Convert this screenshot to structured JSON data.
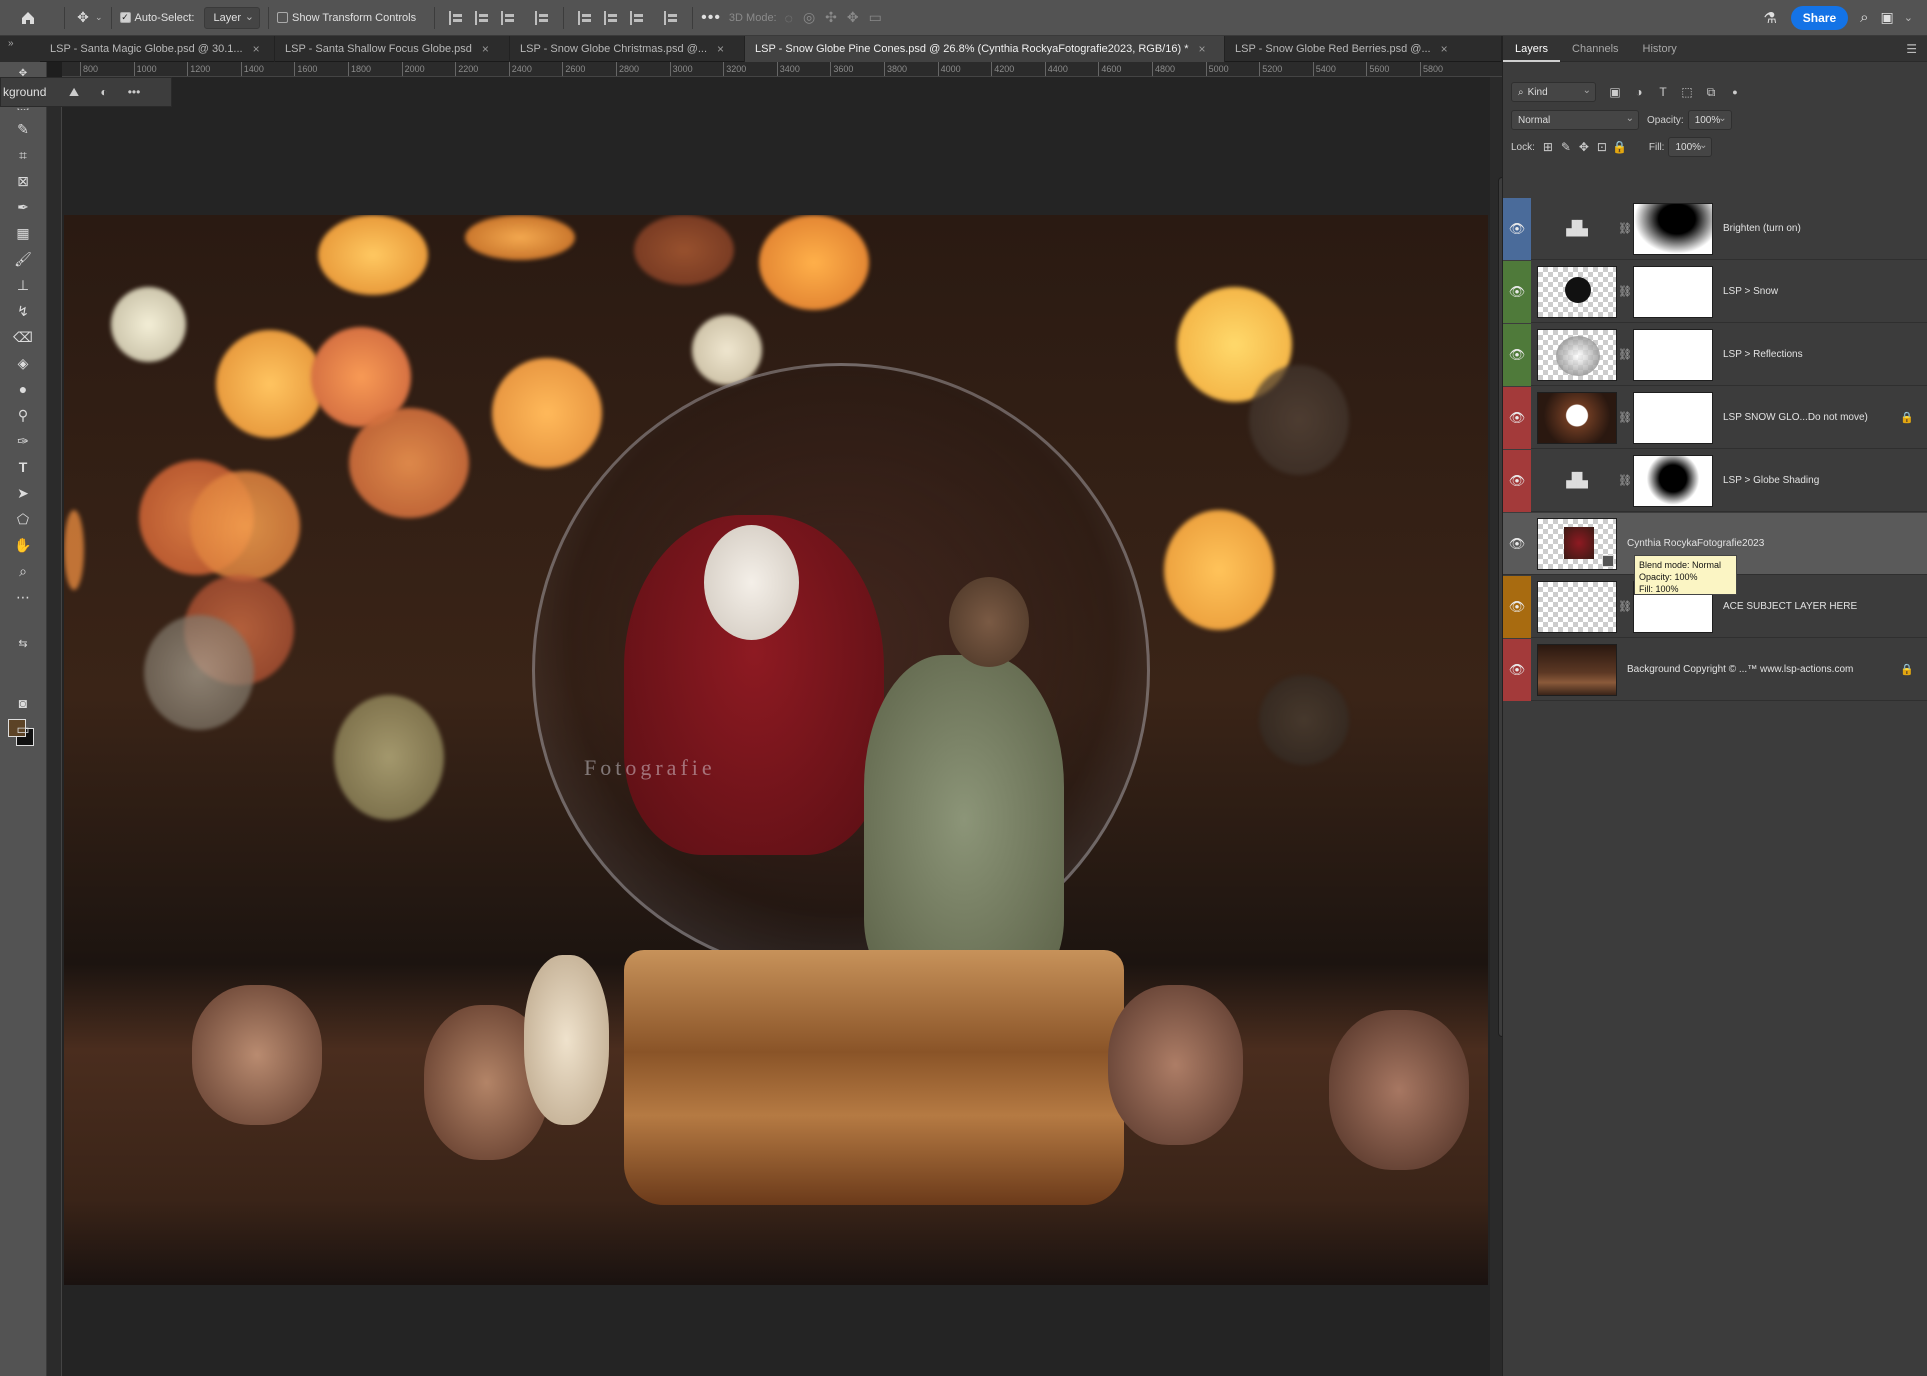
{
  "options_bar": {
    "auto_select_label": "Auto-Select:",
    "layer_select": "Layer",
    "transform_label": "Show Transform Controls",
    "mode_3d_label": "3D Mode:",
    "share_label": "Share"
  },
  "tabs": [
    {
      "label": "LSP - Santa Magic Globe.psd @ 30.1...",
      "close": "×"
    },
    {
      "label": "LSP - Santa Shallow Focus Globe.psd",
      "close": "×"
    },
    {
      "label": "LSP - Snow Globe Christmas.psd @...",
      "close": "×"
    },
    {
      "label": "LSP - Snow Globe Pine Cones.psd @ 26.8% (Cynthia RockyaFotografie2023, RGB/16) *",
      "close": "×"
    },
    {
      "label": "LSP - Snow Globe Red Berries.psd @...",
      "close": "×"
    }
  ],
  "ruler_ticks": [
    "800",
    "1000",
    "1200",
    "1400",
    "1600",
    "1800",
    "2000",
    "2200",
    "2400",
    "2600",
    "2800",
    "3000",
    "3200",
    "3400",
    "3600",
    "3800",
    "4000",
    "4200",
    "4400",
    "4600",
    "4800",
    "5000",
    "5200",
    "5400",
    "5600",
    "5800"
  ],
  "context_bar": {
    "label": "kground"
  },
  "panel": {
    "tabs": [
      "Layers",
      "Channels",
      "History"
    ],
    "kind_label": "Kind",
    "blend_mode": "Normal",
    "opacity_label": "Opacity:",
    "opacity_value": "100%",
    "lock_label": "Lock:",
    "fill_label": "Fill:",
    "fill_value": "100%"
  },
  "layers": [
    {
      "name": "Brighten (turn on)",
      "color": "#4a6b9a",
      "locked": false
    },
    {
      "name": "LSP > Snow",
      "color": "#4f7a3a",
      "locked": false
    },
    {
      "name": "LSP > Reflections",
      "color": "#4f7a3a",
      "locked": false
    },
    {
      "name": "LSP SNOW GLO...Do not move)",
      "color": "#a33a3a",
      "locked": true
    },
    {
      "name": "LSP > Globe Shading",
      "color": "#a33a3a",
      "locked": false
    },
    {
      "name": "Cynthia RocykaFotografie2023",
      "color": "",
      "locked": false
    },
    {
      "name": "ACE SUBJECT LAYER HERE",
      "color": "#a86b10",
      "locked": false
    },
    {
      "name": "Background Copyright © ...™ www.lsp-actions.com",
      "color": "#a33a3a",
      "locked": true
    }
  ],
  "tooltip": {
    "line1": "Blend mode: Normal",
    "line2": "Opacity: 100%",
    "line3": "Fill: 100%"
  },
  "canvas": {
    "watermark": "Fotografie"
  }
}
